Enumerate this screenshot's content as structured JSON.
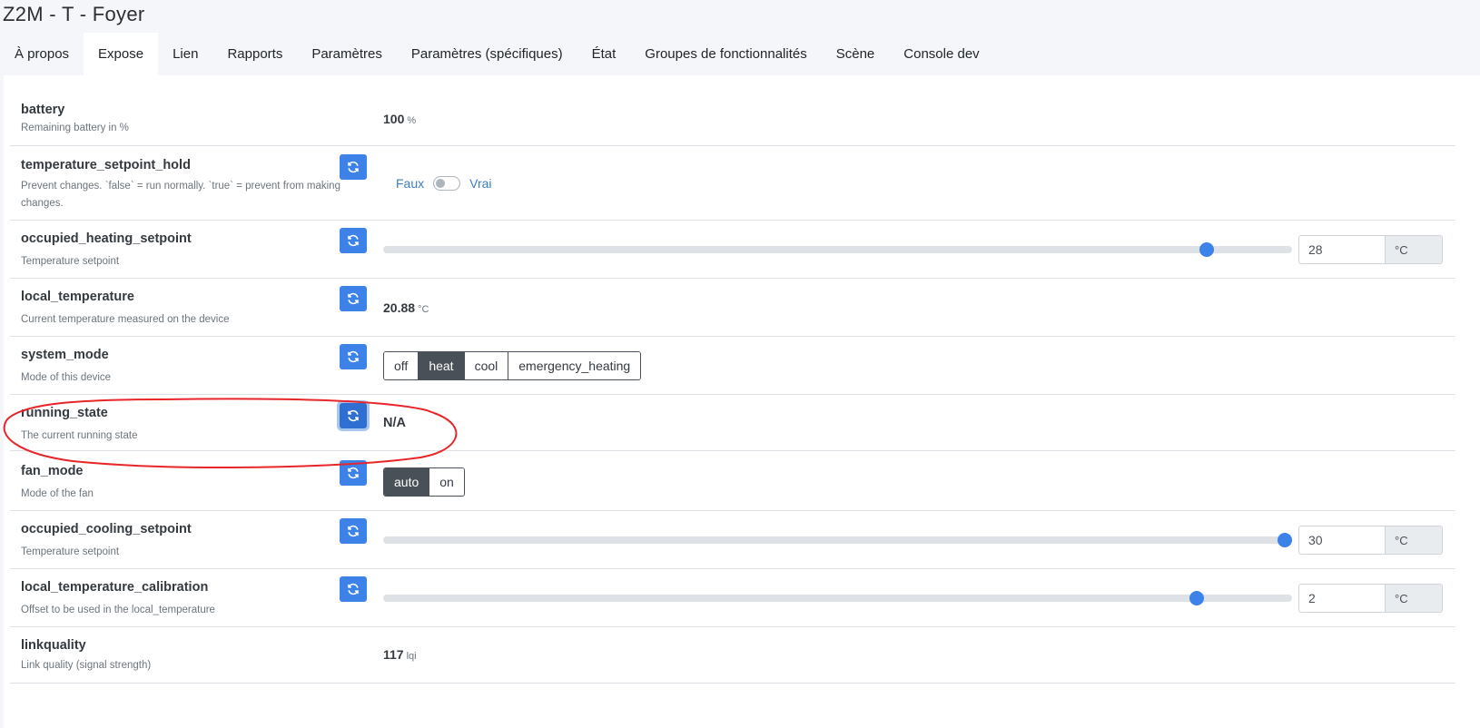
{
  "page": {
    "title": "Z2M - T - Foyer"
  },
  "tabs": [
    {
      "label": "À propos",
      "active": false
    },
    {
      "label": "Expose",
      "active": true
    },
    {
      "label": "Lien",
      "active": false
    },
    {
      "label": "Rapports",
      "active": false
    },
    {
      "label": "Paramètres",
      "active": false
    },
    {
      "label": "Paramètres (spécifiques)",
      "active": false
    },
    {
      "label": "État",
      "active": false
    },
    {
      "label": "Groupes de fonctionnalités",
      "active": false
    },
    {
      "label": "Scène",
      "active": false
    },
    {
      "label": "Console dev",
      "active": false
    }
  ],
  "rows": {
    "battery": {
      "name": "battery",
      "description": "Remaining battery in %",
      "value": "100",
      "unit": "%"
    },
    "temperature_setpoint_hold": {
      "name": "temperature_setpoint_hold",
      "description": "Prevent changes. `false` = run normally. `true` = prevent from making changes.",
      "false_label": "Faux",
      "true_label": "Vrai",
      "checked": false
    },
    "occupied_heating_setpoint": {
      "name": "occupied_heating_setpoint",
      "description": "Temperature setpoint",
      "value": "28",
      "unit": "°C",
      "slider_fraction": 0.906
    },
    "local_temperature": {
      "name": "local_temperature",
      "description": "Current temperature measured on the device",
      "value": "20.88",
      "unit": "°C"
    },
    "system_mode": {
      "name": "system_mode",
      "description": "Mode of this device",
      "options": [
        "off",
        "heat",
        "cool",
        "emergency_heating"
      ],
      "selected": "heat"
    },
    "running_state": {
      "name": "running_state",
      "description": "The current running state",
      "value": "N/A"
    },
    "fan_mode": {
      "name": "fan_mode",
      "description": "Mode of the fan",
      "options": [
        "auto",
        "on"
      ],
      "selected": "auto"
    },
    "occupied_cooling_setpoint": {
      "name": "occupied_cooling_setpoint",
      "description": "Temperature setpoint",
      "value": "30",
      "unit": "°C",
      "slider_fraction": 1.0
    },
    "local_temperature_calibration": {
      "name": "local_temperature_calibration",
      "description": "Offset to be used in the local_temperature",
      "value": "2",
      "unit": "°C",
      "slider_fraction": 0.895
    },
    "linkquality": {
      "name": "linkquality",
      "description": "Link quality (signal strength)",
      "value": "117",
      "unit": "lqi"
    }
  },
  "colors": {
    "accent": "#3c82e8",
    "selected_option": "#495057",
    "annotation": "#e8262a",
    "link": "#3c7ec0"
  },
  "icons": {
    "refresh": "refresh-icon"
  }
}
